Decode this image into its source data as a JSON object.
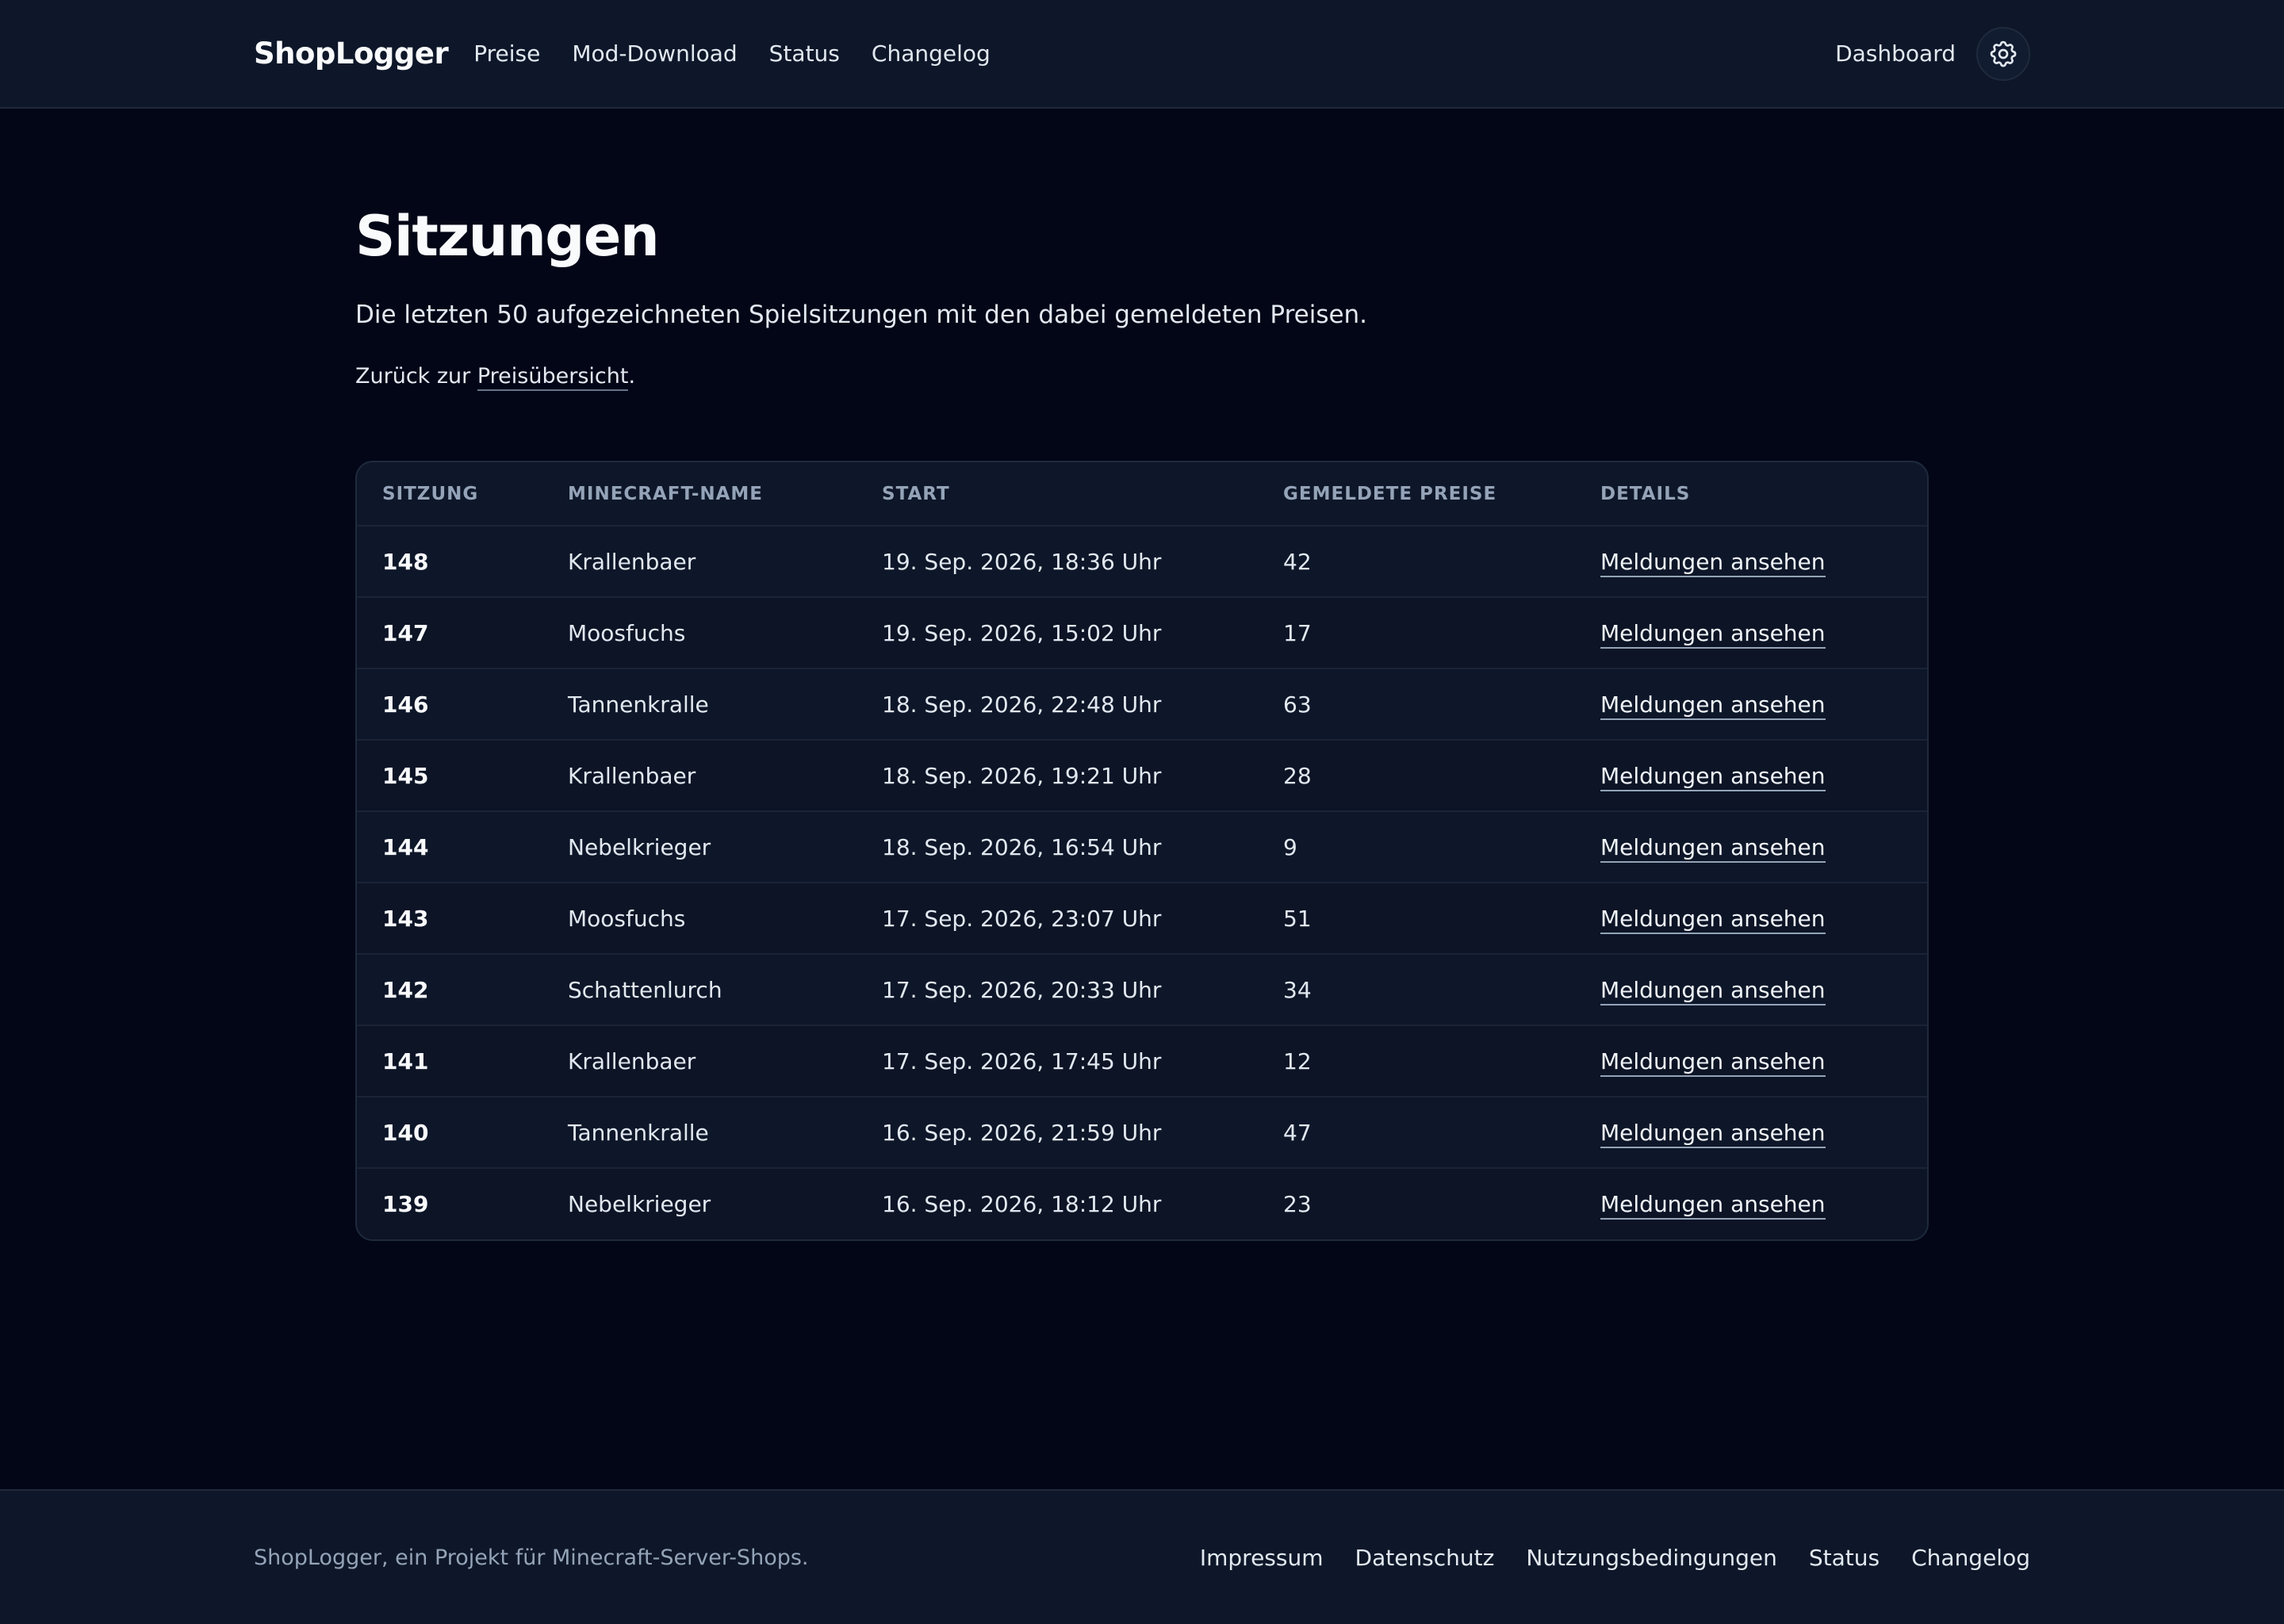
{
  "header": {
    "brand": "ShopLogger",
    "nav": [
      "Preise",
      "Mod-Download",
      "Status",
      "Changelog"
    ],
    "dashboard": "Dashboard",
    "settings_icon": "gear-icon"
  },
  "main": {
    "title": "Sitzungen",
    "subtitle": "Die letzten 50 aufgezeichneten Spielsitzungen mit den dabei gemeldeten Preisen.",
    "back_prefix": "Zurück zur ",
    "back_link": "Preisübersicht",
    "back_suffix": "."
  },
  "table": {
    "headers": [
      "SITZUNG",
      "MINECRAFT-NAME",
      "START",
      "GEMELDETE PREISE",
      "DETAILS"
    ],
    "rows": [
      {
        "id": "148",
        "name": "Krallenbaer",
        "start": "19. Sep. 2026, 18:36 Uhr",
        "prices": "42",
        "details": "Meldungen ansehen"
      },
      {
        "id": "147",
        "name": "Moosfuchs",
        "start": "19. Sep. 2026, 15:02 Uhr",
        "prices": "17",
        "details": "Meldungen ansehen"
      },
      {
        "id": "146",
        "name": "Tannenkralle",
        "start": "18. Sep. 2026, 22:48 Uhr",
        "prices": "63",
        "details": "Meldungen ansehen"
      },
      {
        "id": "145",
        "name": "Krallenbaer",
        "start": "18. Sep. 2026, 19:21 Uhr",
        "prices": "28",
        "details": "Meldungen ansehen"
      },
      {
        "id": "144",
        "name": "Nebelkrieger",
        "start": "18. Sep. 2026, 16:54 Uhr",
        "prices": "9",
        "details": "Meldungen ansehen"
      },
      {
        "id": "143",
        "name": "Moosfuchs",
        "start": "17. Sep. 2026, 23:07 Uhr",
        "prices": "51",
        "details": "Meldungen ansehen"
      },
      {
        "id": "142",
        "name": "Schattenlurch",
        "start": "17. Sep. 2026, 20:33 Uhr",
        "prices": "34",
        "details": "Meldungen ansehen"
      },
      {
        "id": "141",
        "name": "Krallenbaer",
        "start": "17. Sep. 2026, 17:45 Uhr",
        "prices": "12",
        "details": "Meldungen ansehen"
      },
      {
        "id": "140",
        "name": "Tannenkralle",
        "start": "16. Sep. 2026, 21:59 Uhr",
        "prices": "47",
        "details": "Meldungen ansehen"
      },
      {
        "id": "139",
        "name": "Nebelkrieger",
        "start": "16. Sep. 2026, 18:12 Uhr",
        "prices": "23",
        "details": "Meldungen ansehen"
      }
    ]
  },
  "footer": {
    "text": "ShopLogger, ein Projekt für Minecraft-Server-Shops.",
    "links": [
      "Impressum",
      "Datenschutz",
      "Nutzungsbedingungen",
      "Status",
      "Changelog"
    ]
  },
  "colors": {
    "background": "#020617",
    "surface": "#0e1729",
    "border": "#1f2a3d",
    "text": "#e2e8f0",
    "muted": "#94a3b8"
  }
}
